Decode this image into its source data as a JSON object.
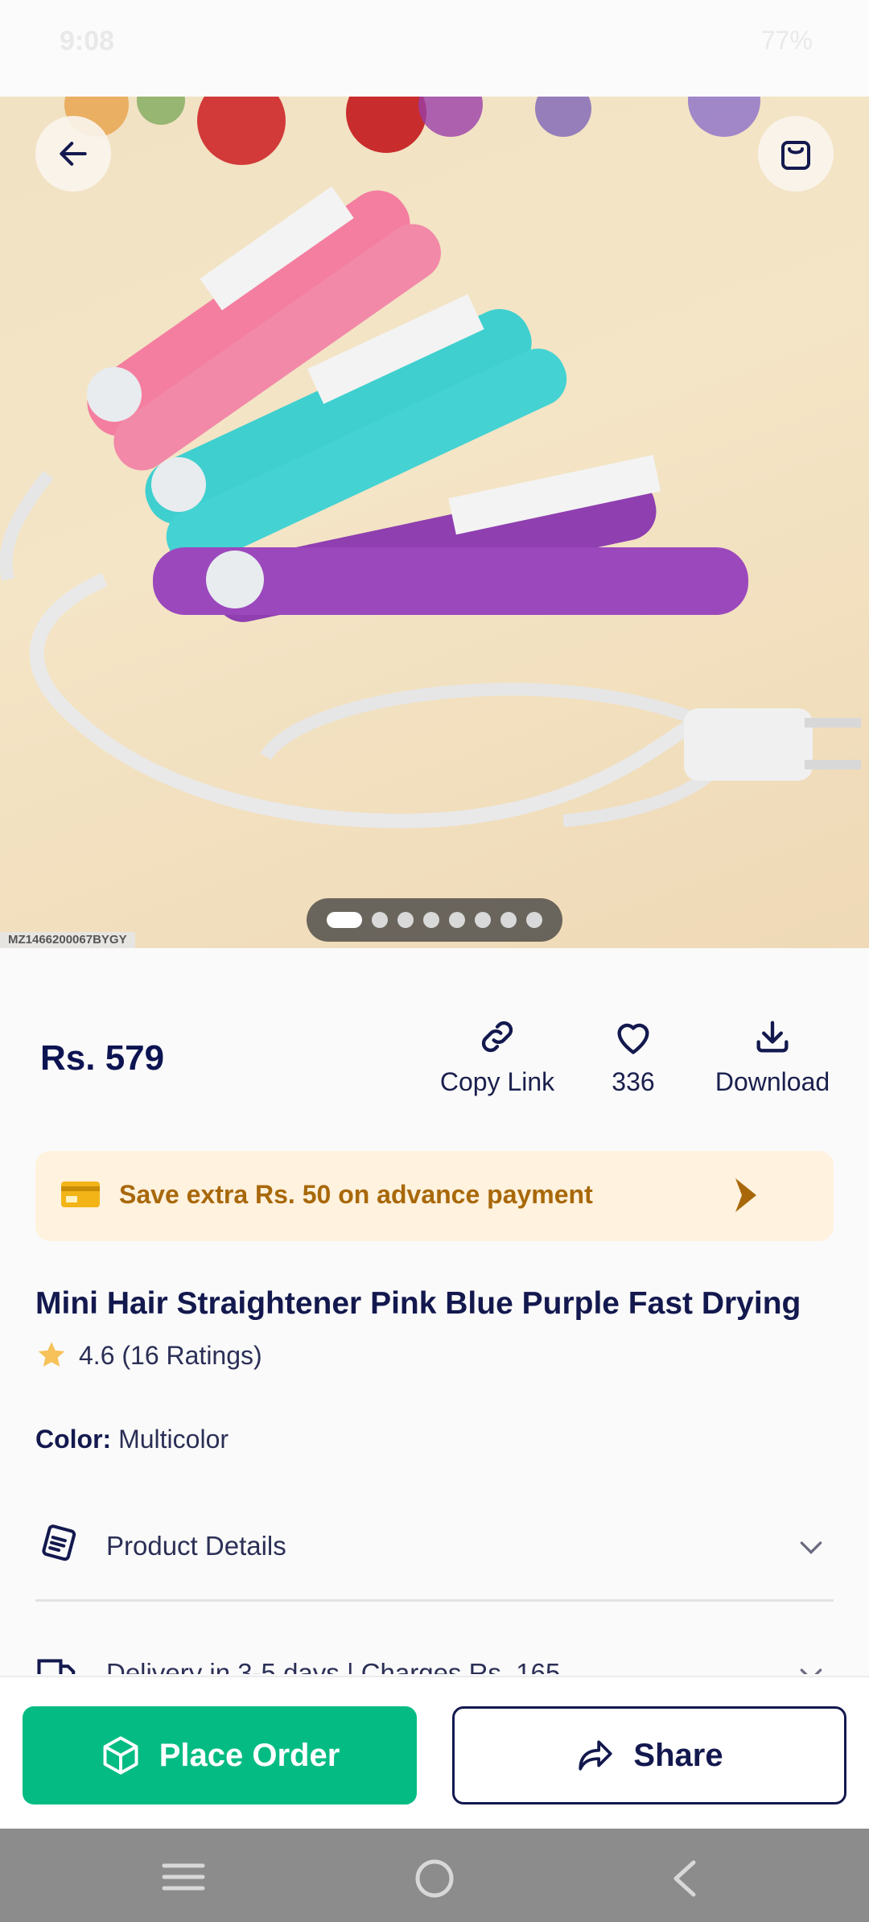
{
  "status_bar": {
    "time": "9:08",
    "battery": "77%"
  },
  "hero": {
    "sku": "MZ1466200067BYGY",
    "image_count": 8,
    "active_index": 0
  },
  "product": {
    "price": "Rs. 579",
    "title": "Mini Hair Straightener Pink Blue Purple Fast Drying",
    "rating": "4.6 (16 Ratings)",
    "color_label": "Color:",
    "color_value": "Multicolor"
  },
  "actions": {
    "copy_link": "Copy Link",
    "wishlist_count": "336",
    "download": "Download"
  },
  "offer": {
    "text": "Save extra Rs. 50 on advance payment"
  },
  "accordion": {
    "product_details": "Product Details",
    "delivery": "Delivery in 3-5 days | Charges Rs. 165"
  },
  "bottom": {
    "place_order": "Place Order",
    "share": "Share"
  },
  "colors": {
    "accent_green": "#04bc83",
    "navy": "#13194e",
    "offer_bg": "#fff2de",
    "offer_text": "#a8680a"
  }
}
